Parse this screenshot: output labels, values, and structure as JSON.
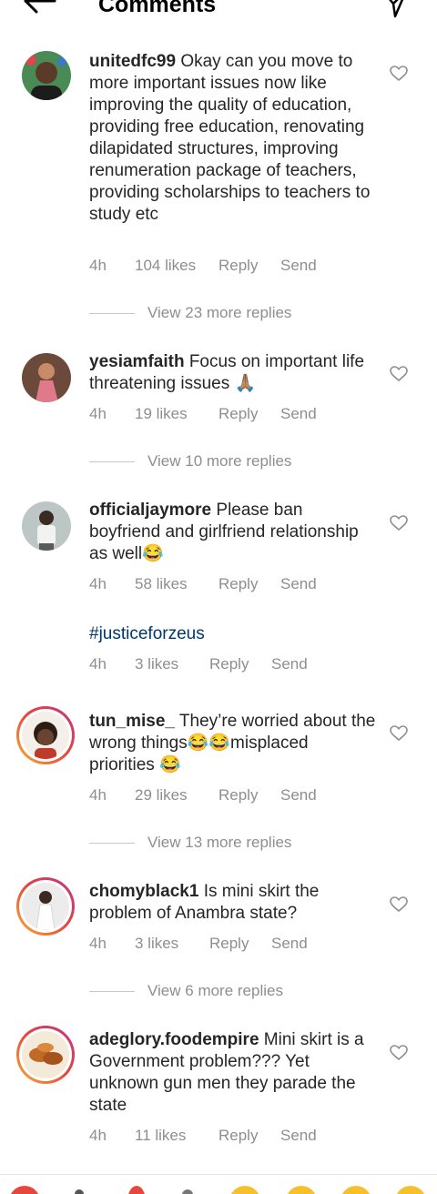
{
  "header": {
    "title": "Comments"
  },
  "comments": [
    {
      "user": "unitedfc99",
      "text": "Okay can you move to more important issues now like improving the quality of education, providing free education, renovating dilapidated structures, improving renumeration package of teachers, providing scholarships to teachers to study etc",
      "time": "4h",
      "likes": "104 likes",
      "reply": "Reply",
      "send": "Send",
      "view_more": "View 23 more replies"
    },
    {
      "user": "yesiamfaith",
      "text": "Focus on important life threatening issues 🙏🏽",
      "time": "4h",
      "likes": "19 likes",
      "reply": "Reply",
      "send": "Send",
      "view_more": "View 10 more replies"
    },
    {
      "user": "officialjaymore",
      "text": "Please ban boyfriend and girlfriend relationship as well😂",
      "time": "4h",
      "likes": "58 likes",
      "reply": "Reply",
      "send": "Send",
      "reply_item": {
        "text": "#justiceforzeus",
        "time": "4h",
        "likes": "3 likes",
        "reply": "Reply",
        "send": "Send"
      }
    },
    {
      "user": "tun_mise_",
      "text": "They’re worried about the wrong things😂😂misplaced priorities 😂",
      "time": "4h",
      "likes": "29 likes",
      "reply": "Reply",
      "send": "Send",
      "view_more": "View 13 more replies"
    },
    {
      "user": "chomyblack1",
      "text": "Is mini skirt the problem of Anambra state?",
      "time": "4h",
      "likes": "3 likes",
      "reply": "Reply",
      "send": "Send",
      "view_more": "View 6 more replies"
    },
    {
      "user": "adeglory.foodempire",
      "text": "Mini skirt is a Government problem??? Yet unknown gun men they parade the state",
      "time": "4h",
      "likes": "11 likes",
      "reply": "Reply",
      "send": "Send"
    }
  ],
  "colors": {
    "meta": "#8e8e8e",
    "text": "#262626",
    "hashtag": "#00376b",
    "ring": "#c13584"
  },
  "icons": {
    "back": "arrow-left-icon",
    "send": "paper-plane-icon",
    "like": "heart-outline-icon"
  }
}
